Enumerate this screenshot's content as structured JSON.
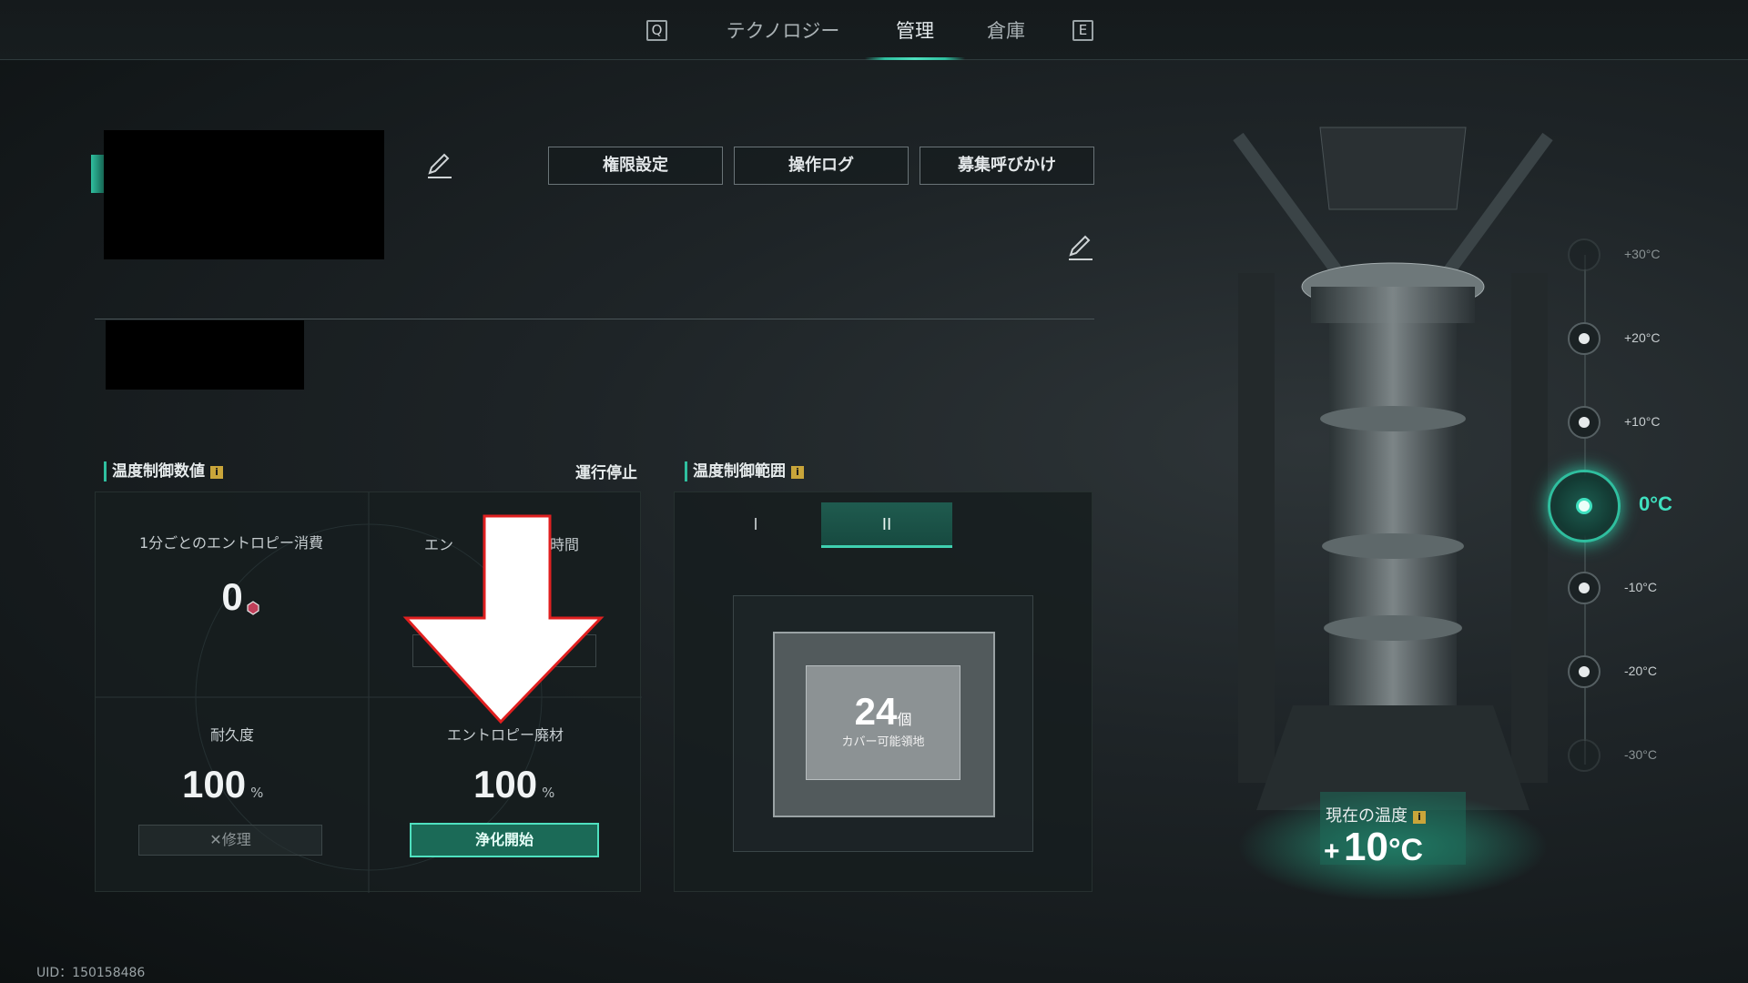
{
  "nav": {
    "q_key": "Q",
    "e_key": "E",
    "tabs": [
      {
        "label": "テクノロジー"
      },
      {
        "label": "管理"
      },
      {
        "label": "倉庫"
      }
    ]
  },
  "header": {
    "buttons": {
      "permissions": "権限設定",
      "operation_log": "操作ログ",
      "recruit": "募集呼びかけ"
    }
  },
  "temp_control": {
    "title": "温度制御数値",
    "status": "運行停止",
    "entropy_per_min_label": "1分ごとのエントロピー消費",
    "entropy_per_min_value": "0",
    "time_label_left": "エン",
    "time_label_right": "時間",
    "durability_label": "耐久度",
    "durability_value": "100",
    "durability_unit": "%",
    "repair_button": "修理",
    "waste_label": "エントロピー廃材",
    "waste_value": "100",
    "waste_unit": "%",
    "purify_button": "浄化開始"
  },
  "temp_range": {
    "title": "温度制御範囲",
    "tabs": [
      {
        "label": "I"
      },
      {
        "label": "II"
      }
    ],
    "active_tab": 1,
    "count": "24",
    "count_unit": "個",
    "coverage_label": "カバー可能領地"
  },
  "scale": {
    "ticks": [
      {
        "label": "+30°C"
      },
      {
        "label": "+20°C"
      },
      {
        "label": "+10°C"
      },
      {
        "label": "0°C"
      },
      {
        "label": "-10°C"
      },
      {
        "label": "-20°C"
      },
      {
        "label": "-30°C"
      }
    ],
    "selected": "0°C"
  },
  "current_temp": {
    "label": "現在の温度",
    "sign": "+",
    "value": "10",
    "unit": "°C"
  },
  "footer": {
    "uid": "UID：150158486"
  },
  "colors": {
    "accent": "#2fbf9f",
    "arrow_fill": "#ffffff",
    "arrow_outline": "#e02020"
  }
}
